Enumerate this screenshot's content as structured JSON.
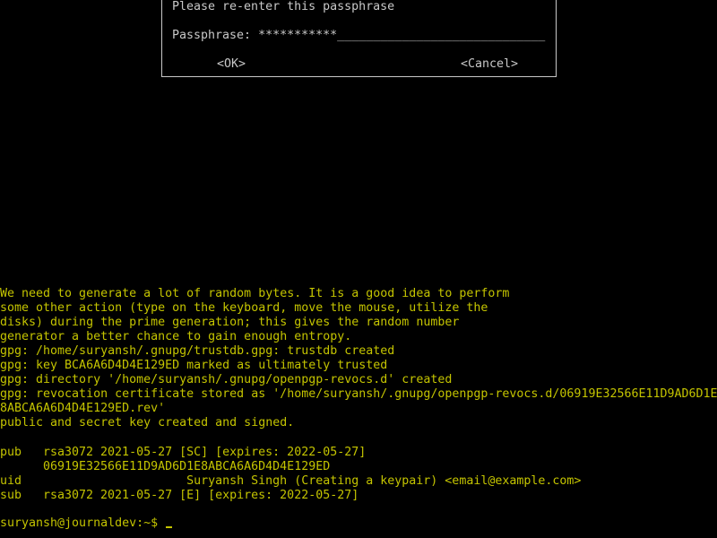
{
  "colors": {
    "background": "#000000",
    "terminal_text": "#c4c400",
    "dialog_text": "#c8c8c8",
    "dialog_border": "#c8c8c8"
  },
  "dialog": {
    "prompt": "Please re-enter this passphrase",
    "passphrase_label": "Passphrase: ",
    "passphrase_masked": "***********",
    "passphrase_field_fill": "_____________________________",
    "ok_label": "<OK>",
    "cancel_label": "<Cancel>"
  },
  "output_lines": [
    "We need to generate a lot of random bytes. It is a good idea to perform",
    "some other action (type on the keyboard, move the mouse, utilize the",
    "disks) during the prime generation; this gives the random number",
    "generator a better chance to gain enough entropy.",
    "gpg: /home/suryansh/.gnupg/trustdb.gpg: trustdb created",
    "gpg: key BCA6A6D4D4E129ED marked as ultimately trusted",
    "gpg: directory '/home/suryansh/.gnupg/openpgp-revocs.d' created",
    "gpg: revocation certificate stored as '/home/suryansh/.gnupg/openpgp-revocs.d/06919E32566E11D9AD6D1E",
    "8ABCA6A6D4D4E129ED.rev'",
    "public and secret key created and signed."
  ],
  "key_listing": [
    {
      "tag": "pub",
      "text": "rsa3072 2021-05-27 [SC] [expires: 2022-05-27]"
    },
    {
      "tag": "",
      "text": "06919E32566E11D9AD6D1E8ABCA6A6D4D4E129ED"
    },
    {
      "tag": "uid",
      "text": "                    Suryansh Singh (Creating a keypair) <email@example.com>"
    },
    {
      "tag": "sub",
      "text": "rsa3072 2021-05-27 [E] [expires: 2022-05-27]"
    }
  ],
  "shell_prompt": "suryansh@journaldev:~$ "
}
